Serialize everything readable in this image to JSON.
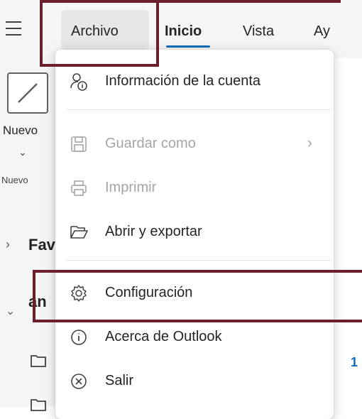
{
  "ribbon": {
    "tabs": [
      {
        "label": "Archivo"
      },
      {
        "label": "Inicio"
      },
      {
        "label": "Vista"
      },
      {
        "label": "Ay"
      }
    ],
    "new_button_label": "Nuevo",
    "group_label": "Nuevo"
  },
  "sidebar": {
    "favorites_label": "Fav",
    "account_label": "an",
    "unread_count": "1"
  },
  "menu": {
    "items": [
      {
        "label": "Información de la cuenta",
        "icon": "account-info-icon"
      },
      {
        "label": "Guardar como",
        "icon": "save-icon"
      },
      {
        "label": "Imprimir",
        "icon": "printer-icon"
      },
      {
        "label": "Abrir y exportar",
        "icon": "folder-open-icon"
      },
      {
        "label": "Configuración",
        "icon": "gear-icon"
      },
      {
        "label": "Acerca de Outlook",
        "icon": "info-icon"
      },
      {
        "label": "Salir",
        "icon": "close-circle-icon"
      }
    ]
  },
  "colors": {
    "accent": "#0f6cbd",
    "highlight_box": "#6b1e2b",
    "disabled_text": "#a6a6a6"
  }
}
